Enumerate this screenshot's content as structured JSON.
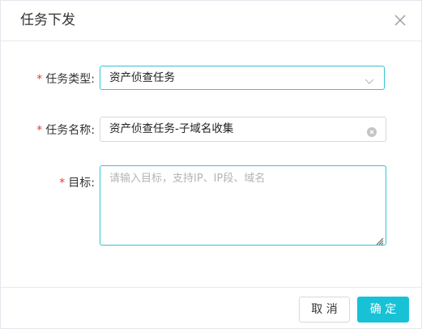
{
  "dialog": {
    "title": "任务下发",
    "close_icon": "close-icon"
  },
  "form": {
    "task_type": {
      "required_mark": "*",
      "label": "任务类型:",
      "value": "资产侦查任务",
      "dropdown_icon": "chevron-down-icon"
    },
    "task_name": {
      "required_mark": "*",
      "label": "任务名称:",
      "value": "资产侦查任务-子域名收集",
      "clear_icon": "clear-circle-icon"
    },
    "target": {
      "required_mark": "*",
      "label": "目标:",
      "placeholder": "请输入目标，支持IP、IP段、域名",
      "resize_icon": "resize-grip-icon"
    }
  },
  "footer": {
    "cancel_label": "取 消",
    "ok_label": "确 定"
  },
  "colors": {
    "accent": "#17c2d6",
    "required": "#e23c3c",
    "focus_border": "#34c4d6"
  }
}
